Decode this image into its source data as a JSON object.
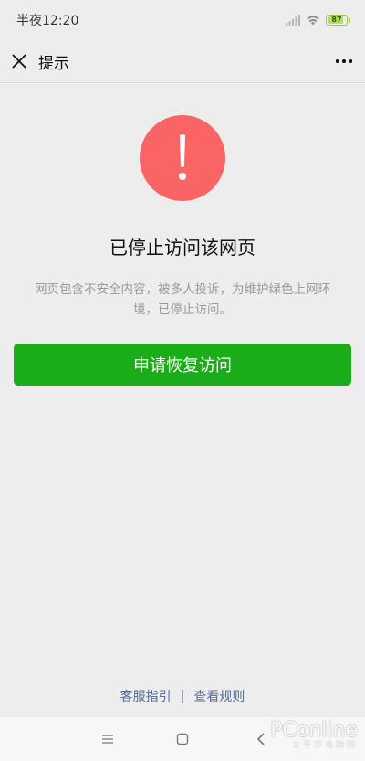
{
  "status_bar": {
    "time": "半夜12:20",
    "battery": "87",
    "battery_level": 0.87,
    "icons": [
      "signal-icon",
      "wifi-icon",
      "battery-icon"
    ]
  },
  "nav": {
    "title": "提示",
    "close_icon": "close-icon",
    "more_icon": "more-icon"
  },
  "main": {
    "icon": "warning-exclamation-icon",
    "icon_color": "#fa6464",
    "title": "已停止访问该网页",
    "description": "网页包含不安全内容，被多人投诉，为维护绿色上网环境，已停止访问。",
    "button_label": "申请恢复访问",
    "button_color": "#1aad19"
  },
  "footer": {
    "link_service": "客服指引",
    "separator": "|",
    "link_rules": "查看规则",
    "link_color": "#576b95"
  },
  "system_nav": {
    "icons": [
      "menu-icon",
      "home-icon",
      "back-icon"
    ]
  },
  "watermark": {
    "text": "PConline",
    "sub_text": "太平洋电脑网"
  }
}
